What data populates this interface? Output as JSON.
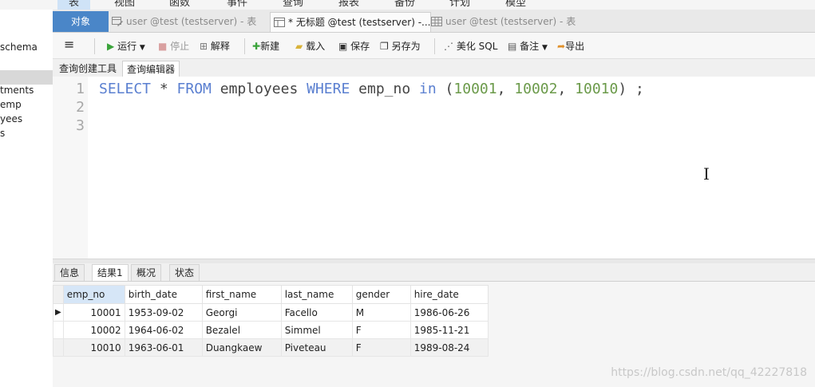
{
  "menu": {
    "items": [
      "表",
      "视图",
      "函数",
      "事件",
      "查询",
      "报表",
      "备份",
      "计划",
      "模型"
    ]
  },
  "navigator": {
    "items": [
      "schema",
      "",
      "tments",
      "emp",
      "yees",
      "s"
    ]
  },
  "tabs": [
    {
      "label": "对象"
    },
    {
      "label": "user @test (testserver) - 表"
    },
    {
      "label": "* 无标题 @test (testserver) -..."
    },
    {
      "label": "user @test (testserver) - 表"
    }
  ],
  "toolbar": {
    "menu_label": "≡",
    "run": "运行",
    "stop": "停止",
    "explain": "解释",
    "new": "新建",
    "load": "载入",
    "save": "保存",
    "save_as": "另存为",
    "beautify": "美化 SQL",
    "memo": "备注",
    "export": "导出"
  },
  "subtabs": [
    "查询创建工具",
    "查询编辑器"
  ],
  "editor": {
    "line_numbers": [
      "1",
      "2",
      "3"
    ],
    "sql": {
      "select": "SELECT",
      "star": " * ",
      "from": "FROM",
      "table": " employees ",
      "where": "WHERE",
      "column": " emp_no ",
      "in": "in",
      "open": " (",
      "v1": "10001",
      "c1": ", ",
      "v2": "10002",
      "c2": ", ",
      "v3": "10010",
      "close": ") ;"
    }
  },
  "result_tabs": [
    "信息",
    "结果1",
    "概况",
    "状态"
  ],
  "grid": {
    "columns": [
      "emp_no",
      "birth_date",
      "first_name",
      "last_name",
      "gender",
      "hire_date"
    ],
    "rows": [
      [
        "10001",
        "1953-09-02",
        "Georgi",
        "Facello",
        "M",
        "1986-06-26"
      ],
      [
        "10002",
        "1964-06-02",
        "Bezalel",
        "Simmel",
        "F",
        "1985-11-21"
      ],
      [
        "10010",
        "1963-06-01",
        "Duangkaew",
        "Piveteau",
        "F",
        "1989-08-24"
      ]
    ]
  },
  "watermark": "https://blog.csdn.net/qq_42227818",
  "colors": {
    "accent": "#4a86c8",
    "keyword": "#5a7fd0",
    "number": "#6b9a4a"
  }
}
